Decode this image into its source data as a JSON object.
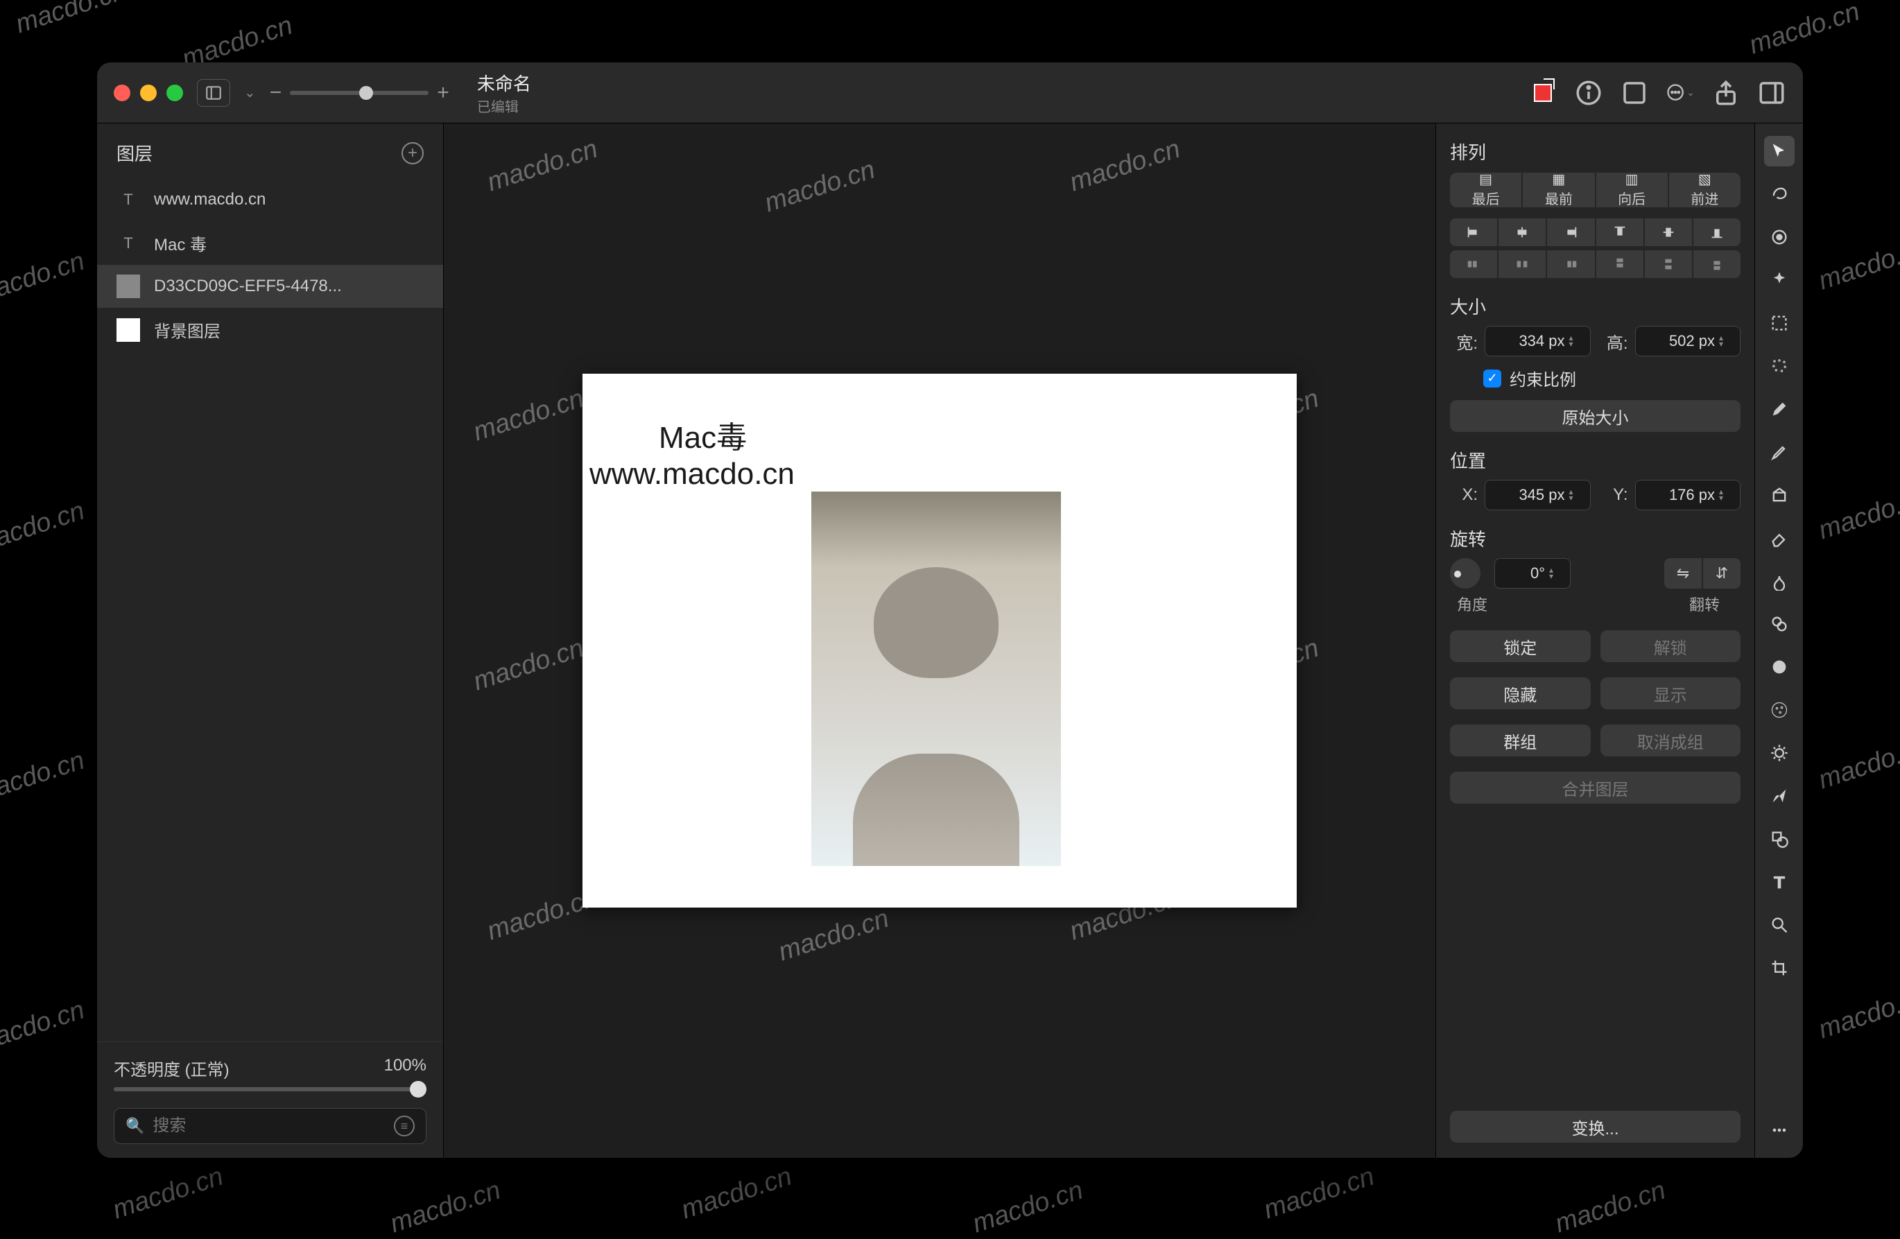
{
  "watermark": "macdo.cn",
  "titlebar": {
    "doc_title": "未命名",
    "doc_status": "已编辑"
  },
  "layers_panel": {
    "title": "图层",
    "items": [
      {
        "kind": "text",
        "label": "www.macdo.cn"
      },
      {
        "kind": "text",
        "label": "Mac 毒"
      },
      {
        "kind": "image",
        "label": "D33CD09C-EFF5-4478...",
        "selected": true
      },
      {
        "kind": "bg",
        "label": "背景图层"
      }
    ],
    "opacity_label": "不透明度 (正常)",
    "opacity_value": "100%",
    "search_placeholder": "搜索"
  },
  "canvas": {
    "text1": "Mac毒",
    "text2": "www.macdo.cn"
  },
  "inspector": {
    "arrange_title": "排列",
    "arrange_segs": [
      "最后",
      "最前",
      "向后",
      "前进"
    ],
    "size_title": "大小",
    "width_label": "宽:",
    "width_value": "334 px",
    "height_label": "高:",
    "height_value": "502 px",
    "constrain_label": "约束比例",
    "original_size_btn": "原始大小",
    "position_title": "位置",
    "x_label": "X:",
    "x_value": "345 px",
    "y_label": "Y:",
    "y_value": "176 px",
    "rotate_title": "旋转",
    "angle_value": "0°",
    "angle_label": "角度",
    "flip_label": "翻转",
    "lock_btn": "锁定",
    "unlock_btn": "解锁",
    "hide_btn": "隐藏",
    "show_btn": "显示",
    "group_btn": "群组",
    "ungroup_btn": "取消成组",
    "merge_btn": "合并图层",
    "transform_btn": "变换..."
  }
}
